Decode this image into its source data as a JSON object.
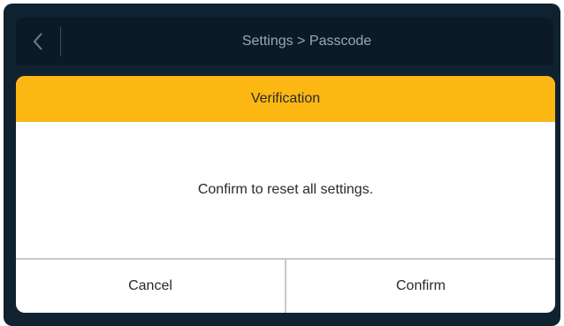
{
  "topbar": {
    "back_icon": "chevron-left-icon",
    "title": "Settings > Passcode"
  },
  "dialog": {
    "title": "Verification",
    "message": "Confirm to reset all settings.",
    "cancel_label": "Cancel",
    "confirm_label": "Confirm"
  },
  "colors": {
    "header_accent": "#fdb713",
    "background": "#102230",
    "topbar": "#0b1a26"
  }
}
